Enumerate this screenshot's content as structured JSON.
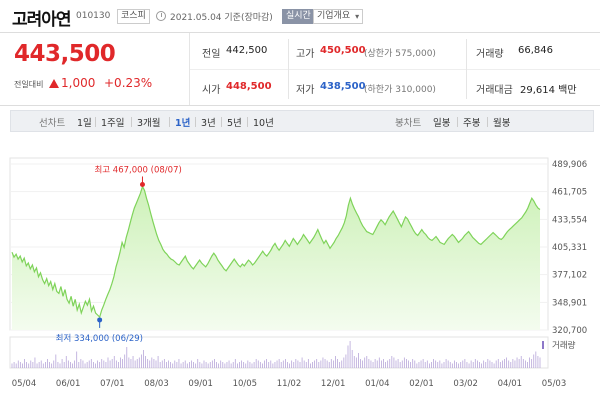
{
  "header": {
    "name": "고려아연",
    "code": "010130",
    "market": "코스피",
    "date": "2021.05.04  기준(장마감)",
    "realtime": "실시간",
    "company": "기업개요"
  },
  "quote": {
    "price": "443,500",
    "change_label": "전일대비",
    "change": "1,000",
    "change_pct": "+0.23%",
    "prev_close_label": "전일",
    "prev_close": "442,500",
    "open_label": "시가",
    "open": "448,500",
    "high_label": "고가",
    "high": "450,500",
    "upper_limit": "(상한가 575,000)",
    "low_label": "저가",
    "low": "438,500",
    "lower_limit": "(하한가 310,000)",
    "volume_label": "거래량",
    "volume": "66,846",
    "amount_label": "거래대금",
    "amount": "29,614 백만"
  },
  "period_bar": {
    "line_label": "선차트",
    "line_options": [
      "1일",
      "1주일",
      "3개월",
      "1년",
      "3년",
      "5년",
      "10년"
    ],
    "active": "1년",
    "candle_label": "봉차트",
    "candle_options": [
      "일봉",
      "주봉",
      "월봉"
    ]
  },
  "colors": {
    "up": "#e0282a",
    "down": "#2c63c8",
    "area": "#7fd35a",
    "area_fill": "#cdf1b8"
  },
  "chart_data": {
    "type": "area",
    "y_ticks": [
      "489,906",
      "461,705",
      "433,554",
      "405,331",
      "377,102",
      "348,901",
      "320,700"
    ],
    "ylim": [
      320700,
      489906
    ],
    "x_ticks": [
      "05/04",
      "06/01",
      "07/01",
      "08/03",
      "09/01",
      "10/05",
      "11/02",
      "12/01",
      "01/04",
      "02/01",
      "03/02",
      "04/01",
      "05/03"
    ],
    "high_annotation": "최고  467,000 (08/07)",
    "low_annotation": "최저  334,000 (06/29)",
    "volume_label": "거래량",
    "series": [
      {
        "values": [
          400000,
          395000,
          398000,
          393000,
          396000,
          390000,
          394000,
          386000,
          389000,
          383000,
          387000,
          380000,
          384000,
          375000,
          379000,
          372000,
          368000,
          373000,
          366000,
          370000,
          362000,
          368000,
          360000,
          358000,
          365000,
          355000,
          362000,
          352000,
          348000,
          355000,
          345000,
          352000,
          341000,
          347000,
          338000,
          344000,
          350000,
          346000,
          352000,
          340000,
          345000,
          338000,
          336000,
          334000,
          341000,
          346000,
          352000,
          357000,
          362000,
          368000,
          375000,
          385000,
          392000,
          400000,
          410000,
          405000,
          415000,
          422000,
          430000,
          438000,
          445000,
          450000,
          455000,
          460000,
          467000,
          463000,
          455000,
          448000,
          440000,
          432000,
          425000,
          418000,
          412000,
          408000,
          403000,
          400000,
          398000,
          395000,
          393000,
          392000,
          390000,
          388000,
          387000,
          390000,
          393000,
          396000,
          391000,
          388000,
          385000,
          383000,
          386000,
          389000,
          392000,
          389000,
          387000,
          385000,
          388000,
          392000,
          396000,
          399000,
          396000,
          392000,
          389000,
          386000,
          383000,
          381000,
          384000,
          387000,
          390000,
          393000,
          390000,
          387000,
          385000,
          388000,
          386000,
          389000,
          392000,
          390000,
          387000,
          389000,
          392000,
          395000,
          398000,
          401000,
          398000,
          396000,
          399000,
          402000,
          406000,
          409000,
          405000,
          402000,
          405000,
          408000,
          412000,
          409000,
          406000,
          410000,
          414000,
          411000,
          408000,
          411000,
          414000,
          418000,
          415000,
          412000,
          409000,
          412000,
          415000,
          419000,
          423000,
          418000,
          413000,
          409000,
          412000,
          408000,
          404000,
          407000,
          410000,
          414000,
          417000,
          421000,
          425000,
          430000,
          437000,
          448000,
          455000,
          449000,
          444000,
          440000,
          436000,
          431000,
          427000,
          424000,
          421000,
          420000,
          419000,
          418000,
          422000,
          426000,
          430000,
          433000,
          431000,
          428000,
          432000,
          436000,
          439000,
          442000,
          438000,
          434000,
          430000,
          426000,
          431000,
          436000,
          434000,
          430000,
          426000,
          422000,
          419000,
          417000,
          420000,
          423000,
          420000,
          418000,
          415000,
          413000,
          412000,
          414000,
          416000,
          413000,
          410000,
          409000,
          408000,
          411000,
          414000,
          416000,
          418000,
          416000,
          413000,
          410000,
          412000,
          414000,
          417000,
          419000,
          421000,
          418000,
          415000,
          413000,
          411000,
          409000,
          408000,
          410000,
          412000,
          414000,
          416000,
          418000,
          420000,
          418000,
          416000,
          414000,
          413000,
          415000,
          418000,
          421000,
          423000,
          425000,
          427000,
          429000,
          431000,
          433000,
          435000,
          438000,
          441000,
          445000,
          450000,
          455000,
          452000,
          448000,
          445000,
          443500
        ]
      }
    ],
    "volume": [
      3,
      4,
      3,
      5,
      4,
      3,
      6,
      4,
      3,
      5,
      4,
      7,
      3,
      4,
      5,
      3,
      4,
      6,
      4,
      3,
      5,
      9,
      4,
      3,
      6,
      4,
      8,
      5,
      4,
      3,
      5,
      11,
      4,
      6,
      5,
      3,
      4,
      5,
      6,
      4,
      3,
      5,
      4,
      6,
      5,
      4,
      7,
      5,
      6,
      8,
      5,
      4,
      7,
      6,
      9,
      14,
      7,
      6,
      8,
      5,
      6,
      7,
      9,
      12,
      8,
      6,
      5,
      7,
      6,
      5,
      8,
      4,
      5,
      6,
      4,
      5,
      4,
      3,
      5,
      4,
      6,
      3,
      4,
      5,
      3,
      4,
      5,
      4,
      3,
      6,
      4,
      3,
      5,
      4,
      3,
      4,
      5,
      6,
      4,
      3,
      5,
      4,
      3,
      4,
      5,
      3,
      4,
      6,
      3,
      4,
      5,
      4,
      3,
      5,
      4,
      3,
      4,
      6,
      5,
      4,
      3,
      5,
      6,
      4,
      5,
      3,
      4,
      5,
      6,
      4,
      5,
      6,
      4,
      3,
      5,
      4,
      6,
      5,
      4,
      7,
      5,
      4,
      6,
      3,
      4,
      5,
      6,
      4,
      5,
      7,
      6,
      5,
      4,
      6,
      5,
      8,
      6,
      4,
      5,
      7,
      9,
      15,
      18,
      12,
      8,
      7,
      10,
      6,
      5,
      7,
      8,
      6,
      5,
      4,
      6,
      5,
      7,
      5,
      6,
      4,
      5,
      6,
      8,
      7,
      5,
      6,
      4,
      5,
      7,
      6,
      5,
      4,
      6,
      5,
      3,
      4,
      5,
      6,
      4,
      5,
      3,
      4,
      6,
      5,
      4,
      5,
      3,
      4,
      6,
      5,
      4,
      3,
      5,
      4,
      3,
      4,
      5,
      6,
      4,
      3,
      5,
      4,
      6,
      5,
      4,
      3,
      5,
      4,
      6,
      5,
      4,
      3,
      5,
      6,
      4,
      5,
      6,
      7,
      5,
      4,
      6,
      5,
      7,
      6,
      8,
      6,
      5,
      4,
      7,
      6,
      9,
      11,
      8,
      7
    ]
  }
}
